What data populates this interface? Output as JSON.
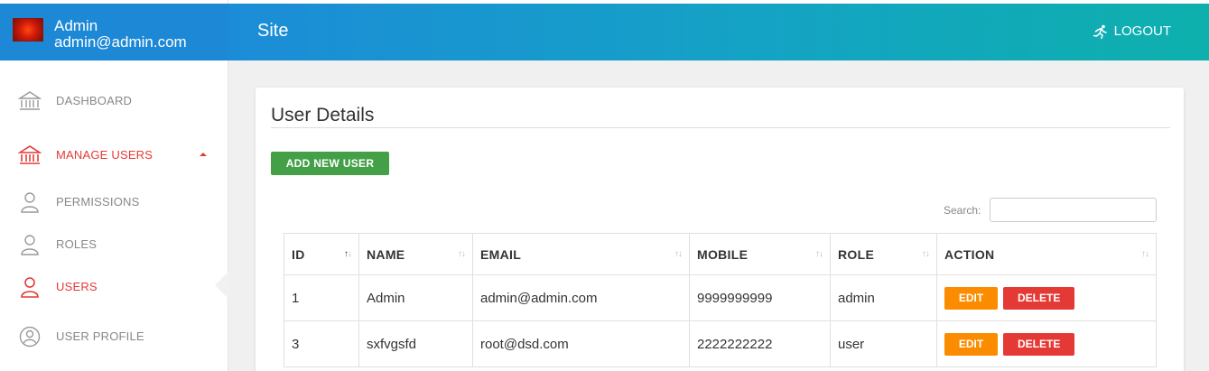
{
  "user": {
    "name": "Admin",
    "email": "admin@admin.com"
  },
  "nav": {
    "dashboard": "DASHBOARD",
    "manage_users": "MANAGE USERS",
    "permissions": "PERMISSIONS",
    "roles": "ROLES",
    "users": "USERS",
    "user_profile": "USER PROFILE"
  },
  "header": {
    "title": "Site",
    "logout": "LOGOUT"
  },
  "card": {
    "title": "User Details",
    "add_button": "ADD NEW USER"
  },
  "search": {
    "label": "Search:",
    "value": ""
  },
  "table": {
    "columns": [
      "ID",
      "NAME",
      "EMAIL",
      "MOBILE",
      "ROLE",
      "ACTION"
    ],
    "rows": [
      {
        "id": "1",
        "name": "Admin",
        "email": "admin@admin.com",
        "mobile": "9999999999",
        "role": "admin"
      },
      {
        "id": "3",
        "name": "sxfvgsfd",
        "email": "root@dsd.com",
        "mobile": "2222222222",
        "role": "user"
      }
    ],
    "edit_label": "EDIT",
    "delete_label": "DELETE"
  },
  "colors": {
    "accent": "#e53935",
    "header_start": "#1c8cd8",
    "header_end": "#0eb0ad",
    "add": "#43a047",
    "edit": "#fb8c00"
  }
}
